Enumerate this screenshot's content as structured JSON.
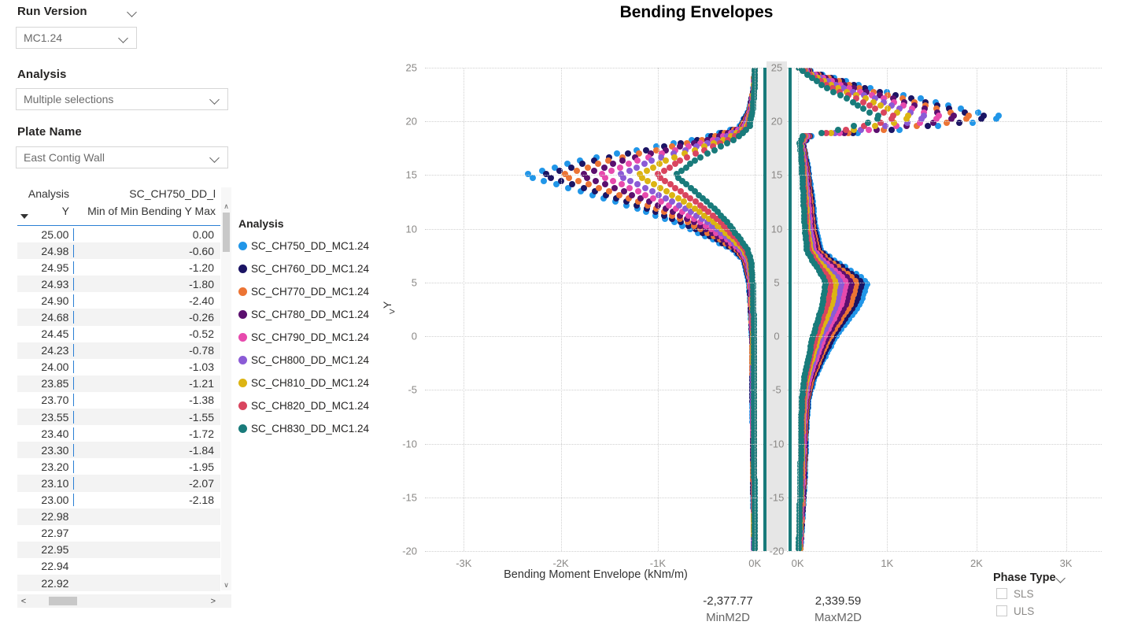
{
  "filters": {
    "run_version": {
      "title": "Run Version",
      "value": "MC1.24"
    },
    "analysis": {
      "title": "Analysis",
      "value": "Multiple selections"
    },
    "plate_name": {
      "title": "Plate Name",
      "value": "East Contig Wall"
    }
  },
  "table": {
    "header_group_left": "Analysis",
    "header_group_right": "SC_CH750_DD_l",
    "columns": [
      "Y",
      "Min of Min Bending Y",
      "Max"
    ],
    "rows": [
      {
        "y": "25.00",
        "v": "0.00"
      },
      {
        "y": "24.98",
        "v": "-0.60"
      },
      {
        "y": "24.95",
        "v": "-1.20"
      },
      {
        "y": "24.93",
        "v": "-1.80"
      },
      {
        "y": "24.90",
        "v": "-2.40"
      },
      {
        "y": "24.68",
        "v": "-0.26"
      },
      {
        "y": "24.45",
        "v": "-0.52"
      },
      {
        "y": "24.23",
        "v": "-0.78"
      },
      {
        "y": "24.00",
        "v": "-1.03"
      },
      {
        "y": "23.85",
        "v": "-1.21"
      },
      {
        "y": "23.70",
        "v": "-1.38"
      },
      {
        "y": "23.55",
        "v": "-1.55"
      },
      {
        "y": "23.40",
        "v": "-1.72"
      },
      {
        "y": "23.30",
        "v": "-1.84"
      },
      {
        "y": "23.20",
        "v": "-1.95"
      },
      {
        "y": "23.10",
        "v": "-2.07"
      },
      {
        "y": "23.00",
        "v": "-2.18"
      },
      {
        "y": "22.98",
        "v": ""
      },
      {
        "y": "22.97",
        "v": ""
      },
      {
        "y": "22.95",
        "v": ""
      },
      {
        "y": "22.94",
        "v": ""
      },
      {
        "y": "22.92",
        "v": ""
      }
    ],
    "scroll_left_arrow": "<",
    "scroll_right_arrow": ">",
    "scroll_up_arrow": "∧",
    "scroll_down_arrow": "∨"
  },
  "legend": {
    "title": "Analysis",
    "overflow_arrow": ">",
    "items": [
      {
        "label": "SC_CH750_DD_MC1.24",
        "color": "#2196e8"
      },
      {
        "label": "SC_CH760_DD_MC1.24",
        "color": "#1b1464"
      },
      {
        "label": "SC_CH770_DD_MC1.24",
        "color": "#ec7434"
      },
      {
        "label": "SC_CH780_DD_MC1.24",
        "color": "#5b0f6e"
      },
      {
        "label": "SC_CH790_DD_MC1.24",
        "color": "#e74aad"
      },
      {
        "label": "SC_CH800_DD_MC1.24",
        "color": "#8b5bd6"
      },
      {
        "label": "SC_CH810_DD_MC1.24",
        "color": "#dcb413"
      },
      {
        "label": "SC_CH820_DD_MC1.24",
        "color": "#d9455f"
      },
      {
        "label": "SC_CH830_DD_MC1.24",
        "color": "#197b7b"
      }
    ]
  },
  "chart_data": {
    "type": "scatter",
    "title": "Bending Envelopes",
    "xlabel": "Bending Moment Envelope (kNm/m)",
    "ylabel": "Y",
    "grid": true,
    "legend_position": "left",
    "panels": [
      {
        "name": "MinM2D",
        "xticks": [
          "-3K",
          "-2K",
          "-1K",
          "0K"
        ],
        "xtickvals": [
          -3000,
          -2000,
          -1000,
          0
        ],
        "xlim": [
          -3400,
          120
        ],
        "ylim": [
          -20,
          25
        ],
        "yticks": [
          25,
          20,
          15,
          10,
          5,
          0,
          -5,
          -10,
          -15,
          -20
        ]
      },
      {
        "name": "MaxM2D",
        "xticks": [
          "0K",
          "1K",
          "2K",
          "3K"
        ],
        "xtickvals": [
          0,
          1000,
          2000,
          3000
        ],
        "xlim": [
          -120,
          3400
        ],
        "ylim": [
          -20,
          25
        ],
        "yticks": [
          25,
          20,
          15,
          10,
          5,
          0,
          -5,
          -10,
          -15,
          -20
        ]
      }
    ],
    "series_names": [
      "SC_CH750_DD_MC1.24",
      "SC_CH760_DD_MC1.24",
      "SC_CH770_DD_MC1.24",
      "SC_CH780_DD_MC1.24",
      "SC_CH790_DD_MC1.24",
      "SC_CH800_DD_MC1.24",
      "SC_CH810_DD_MC1.24",
      "SC_CH820_DD_MC1.24",
      "SC_CH830_DD_MC1.24"
    ],
    "series_colors": [
      "#2196e8",
      "#1b1464",
      "#ec7434",
      "#5b0f6e",
      "#e74aad",
      "#8b5bd6",
      "#dcb413",
      "#d9455f",
      "#197b7b"
    ],
    "min_envelope_profile": [
      {
        "y": 25,
        "x": 0
      },
      {
        "y": 23,
        "x": -15
      },
      {
        "y": 21,
        "x": -60
      },
      {
        "y": 19.5,
        "x": -160
      },
      {
        "y": 18.5,
        "x": -520
      },
      {
        "y": 17.5,
        "x": -1100
      },
      {
        "y": 16.5,
        "x": -1750
      },
      {
        "y": 15.5,
        "x": -2150
      },
      {
        "y": 15,
        "x": -2377
      },
      {
        "y": 14.5,
        "x": -2200
      },
      {
        "y": 13.5,
        "x": -1800
      },
      {
        "y": 12,
        "x": -1250
      },
      {
        "y": 10.5,
        "x": -800
      },
      {
        "y": 9,
        "x": -430
      },
      {
        "y": 8,
        "x": -220
      },
      {
        "y": 7,
        "x": -110
      },
      {
        "y": 5,
        "x": -60
      },
      {
        "y": 2,
        "x": -40
      },
      {
        "y": 0,
        "x": -30
      },
      {
        "y": -5,
        "x": -25
      },
      {
        "y": -10,
        "x": -20
      },
      {
        "y": -15,
        "x": -15
      },
      {
        "y": -20,
        "x": -10
      }
    ],
    "max_envelope_profile": [
      {
        "y": 25,
        "x": 20
      },
      {
        "y": 24,
        "x": 420
      },
      {
        "y": 23,
        "x": 850
      },
      {
        "y": 22,
        "x": 1450
      },
      {
        "y": 21,
        "x": 1900
      },
      {
        "y": 20.4,
        "x": 2339
      },
      {
        "y": 20,
        "x": 2100
      },
      {
        "y": 19.5,
        "x": 1500
      },
      {
        "y": 19,
        "x": 800
      },
      {
        "y": 18.6,
        "x": 150
      },
      {
        "y": 18,
        "x": 60
      },
      {
        "y": 16,
        "x": 110
      },
      {
        "y": 13,
        "x": 160
      },
      {
        "y": 10,
        "x": 200
      },
      {
        "y": 8,
        "x": 260
      },
      {
        "y": 7,
        "x": 420
      },
      {
        "y": 6,
        "x": 620
      },
      {
        "y": 5,
        "x": 780
      },
      {
        "y": 3,
        "x": 700
      },
      {
        "y": 1,
        "x": 520
      },
      {
        "y": 0,
        "x": 430
      },
      {
        "y": -2,
        "x": 300
      },
      {
        "y": -4,
        "x": 180
      },
      {
        "y": -6,
        "x": 120
      },
      {
        "y": -8,
        "x": 100
      },
      {
        "y": -10,
        "x": 90
      },
      {
        "y": -13,
        "x": 80
      },
      {
        "y": -16,
        "x": 60
      },
      {
        "y": -20,
        "x": 30
      }
    ]
  },
  "stats": [
    {
      "value": "-2,377.77",
      "key": "MinM2D"
    },
    {
      "value": "2,339.59",
      "key": "MaxM2D"
    }
  ],
  "phase_type": {
    "title": "Phase Type",
    "options": [
      {
        "label": "SLS",
        "checked": false
      },
      {
        "label": "ULS",
        "checked": false
      }
    ]
  }
}
